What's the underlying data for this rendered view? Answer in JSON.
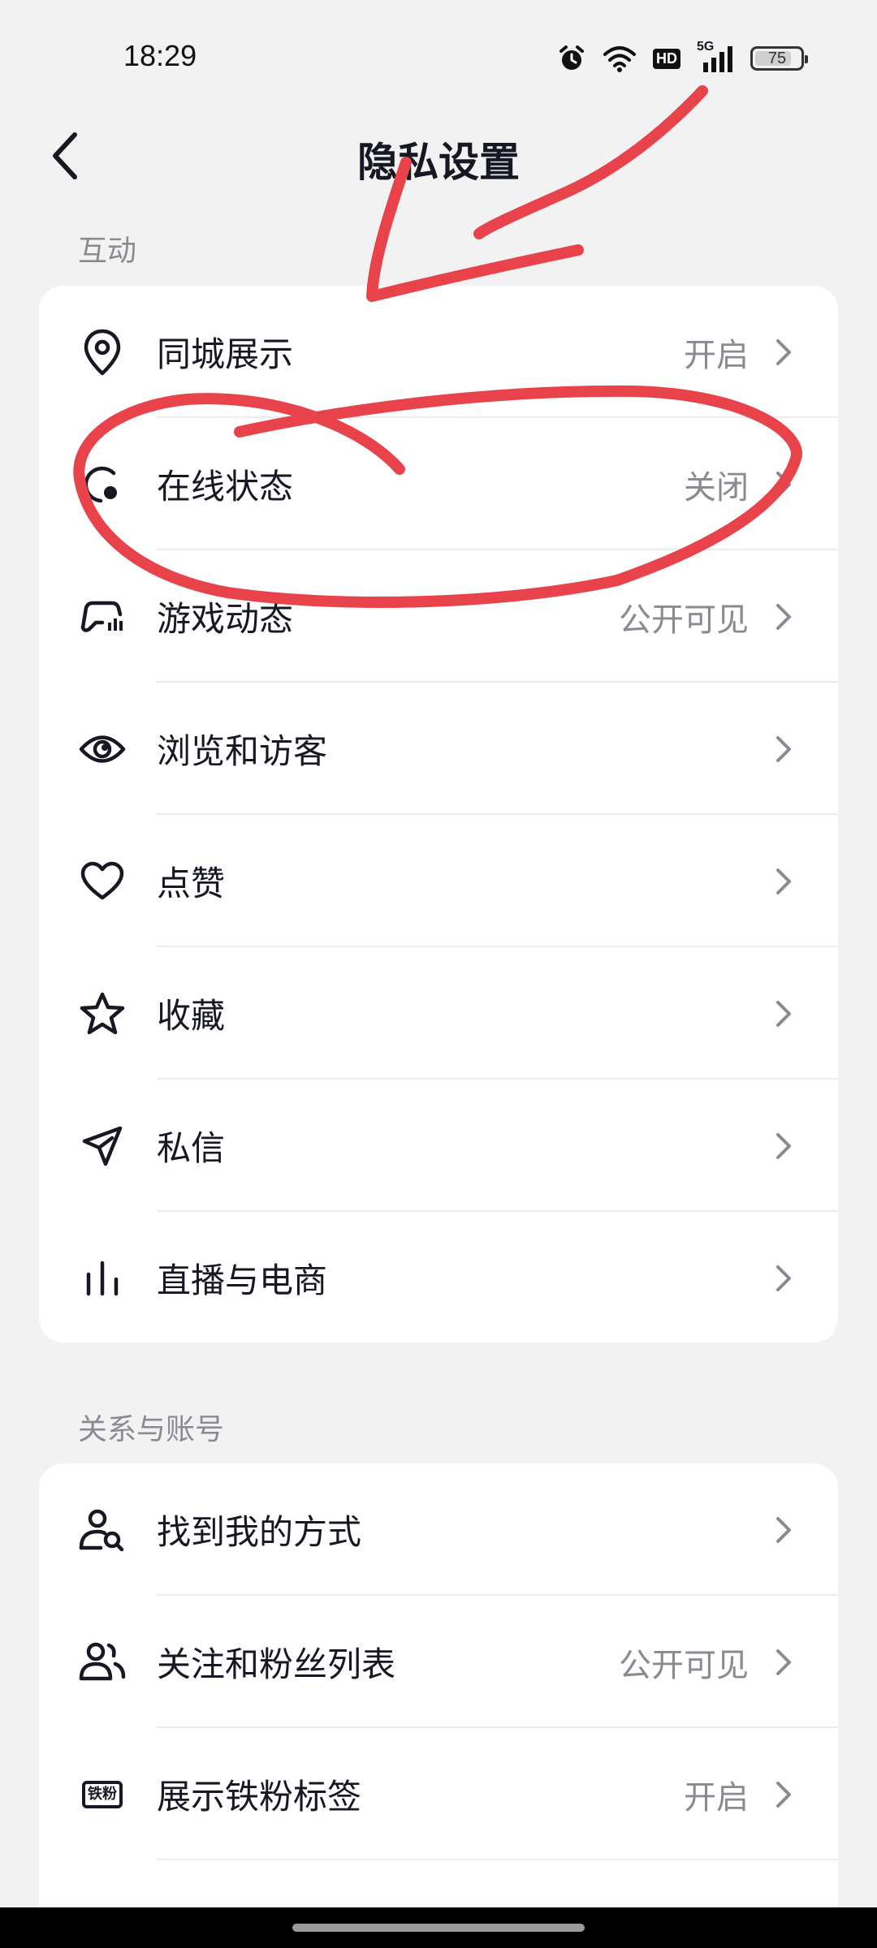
{
  "status_bar": {
    "time": "18:29",
    "network": "5G",
    "hd": "HD",
    "battery": "75"
  },
  "header": {
    "title": "隐私设置"
  },
  "sections": [
    {
      "label": "互动",
      "items": [
        {
          "label": "同城展示",
          "value": "开启",
          "icon": "location-pin-icon"
        },
        {
          "label": "在线状态",
          "value": "关闭",
          "icon": "online-status-icon"
        },
        {
          "label": "游戏动态",
          "value": "公开可见",
          "icon": "gamepad-icon"
        },
        {
          "label": "浏览和访客",
          "value": "",
          "icon": "eye-icon"
        },
        {
          "label": "点赞",
          "value": "",
          "icon": "heart-icon"
        },
        {
          "label": "收藏",
          "value": "",
          "icon": "star-icon"
        },
        {
          "label": "私信",
          "value": "",
          "icon": "paper-plane-icon"
        },
        {
          "label": "直播与电商",
          "value": "",
          "icon": "bars-icon"
        }
      ]
    },
    {
      "label": "关系与账号",
      "items": [
        {
          "label": "找到我的方式",
          "value": "",
          "icon": "user-search-icon"
        },
        {
          "label": "关注和粉丝列表",
          "value": "公开可见",
          "icon": "users-icon"
        },
        {
          "label": "展示铁粉标签",
          "value": "开启",
          "icon": "fan-badge-icon",
          "icon_text": "铁粉"
        }
      ]
    }
  ],
  "colors": {
    "annotation": "#e8434b",
    "value_text": "#8a8b91",
    "background": "#f2f2f2"
  }
}
